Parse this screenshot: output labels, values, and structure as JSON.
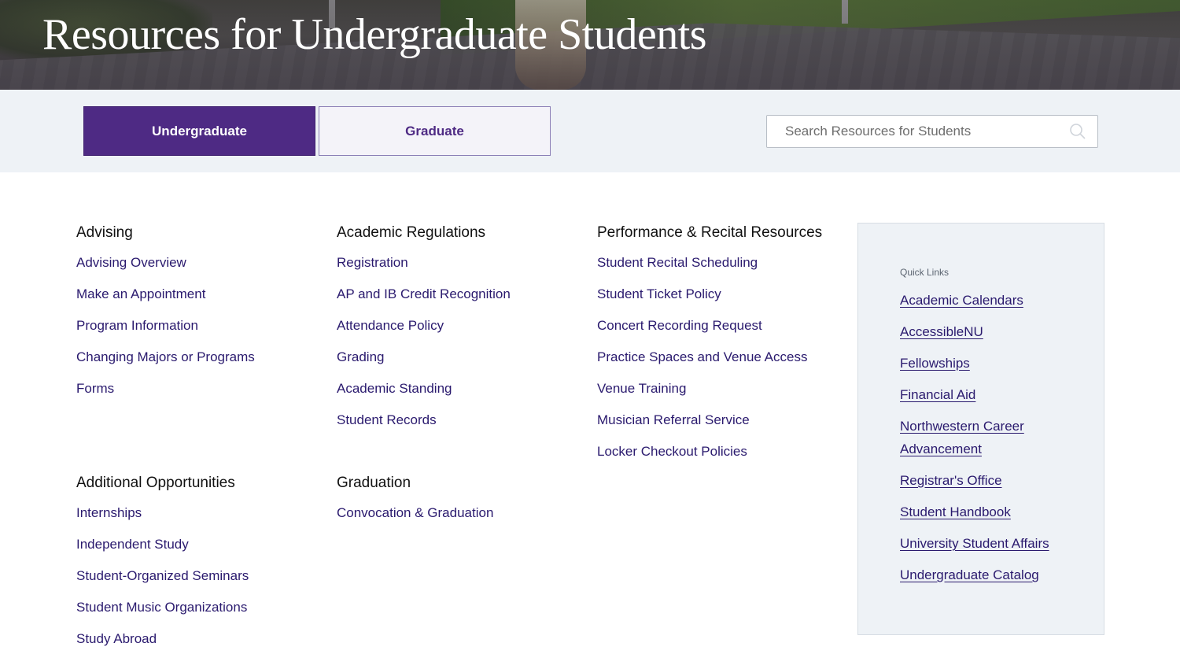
{
  "hero": {
    "title": "Resources for Undergraduate Students"
  },
  "tabs": [
    {
      "label": "Undergraduate",
      "active": true
    },
    {
      "label": "Graduate",
      "active": false
    }
  ],
  "search": {
    "placeholder": "Search Resources for Students",
    "icon": "search-icon"
  },
  "sections": {
    "advising": {
      "heading": "Advising",
      "links": [
        "Advising Overview",
        "Make an Appointment",
        "Program Information",
        "Changing Majors or Programs",
        "Forms"
      ]
    },
    "academic_regulations": {
      "heading": "Academic Regulations",
      "links": [
        "Registration",
        "AP and IB Credit Recognition",
        "Attendance Policy",
        "Grading",
        "Academic Standing",
        "Student Records"
      ]
    },
    "performance": {
      "heading": "Performance & Recital Resources",
      "links": [
        "Student Recital Scheduling",
        "Student Ticket Policy",
        "Concert Recording Request",
        "Practice Spaces and Venue Access",
        "Venue Training",
        "Musician Referral Service",
        "Locker Checkout Policies"
      ]
    },
    "additional": {
      "heading": "Additional Opportunities",
      "links": [
        "Internships",
        "Independent Study",
        "Student-Organized Seminars",
        "Student Music Organizations",
        "Study Abroad"
      ]
    },
    "graduation": {
      "heading": "Graduation",
      "links": [
        "Convocation & Graduation"
      ]
    }
  },
  "quick_links": {
    "title": "Quick Links",
    "links": [
      "Academic Calendars",
      "AccessibleNU",
      "Fellowships",
      "Financial Aid",
      "Northwestern Career Advancement",
      "Registrar's Office",
      "Student Handbook",
      "University Student Affairs",
      "Undergraduate Catalog"
    ]
  },
  "colors": {
    "accent": "#4e2a84",
    "link": "#2a1a6e",
    "panel": "#eef2f6"
  }
}
